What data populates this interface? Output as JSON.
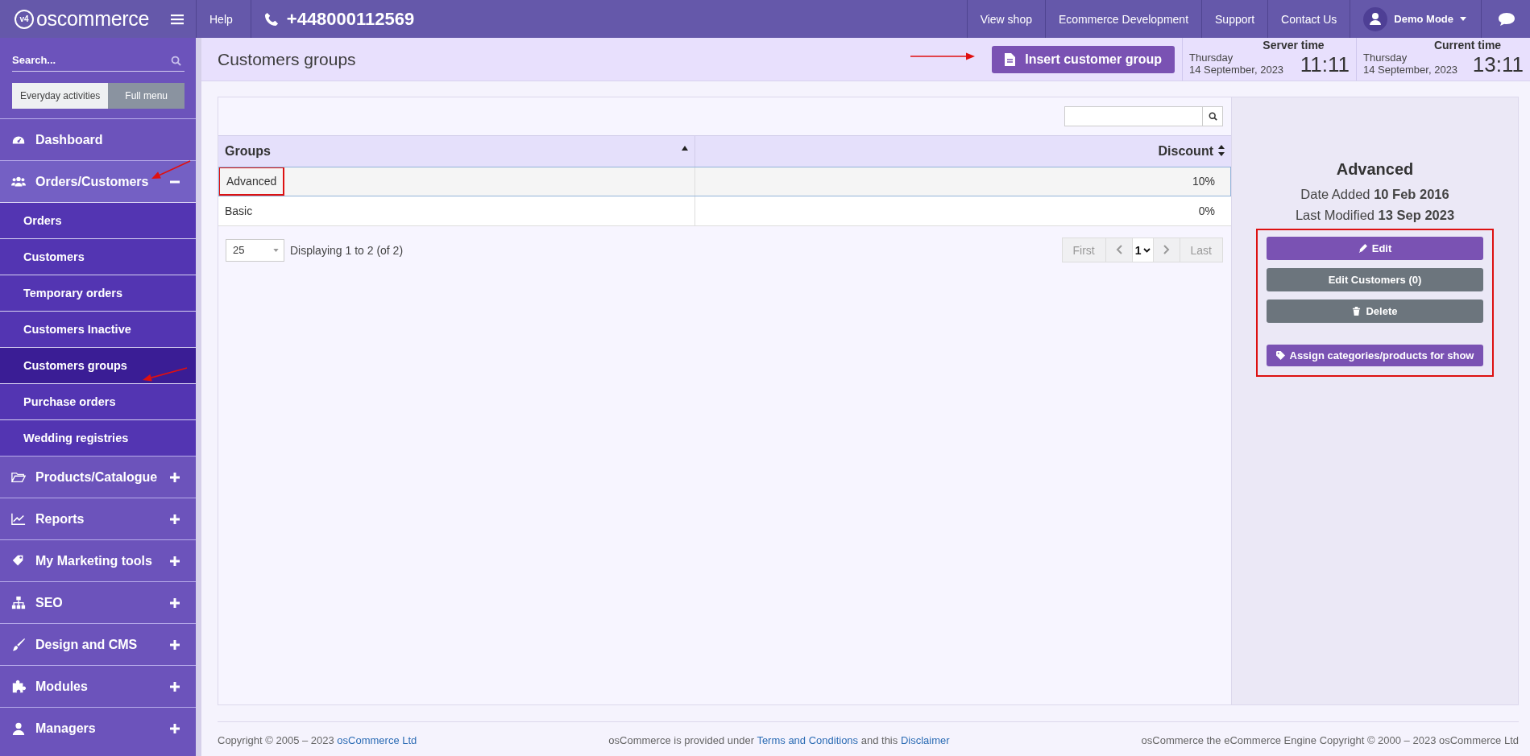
{
  "topbar": {
    "logo": "oscommerce",
    "logo_badge": "v4",
    "help": "Help",
    "phone": "+448000112569",
    "links": [
      "View shop",
      "Ecommerce Development",
      "Support",
      "Contact Us"
    ],
    "user": "Demo Mode"
  },
  "sidebar": {
    "search_placeholder": "Search...",
    "modes": [
      {
        "label": "Everyday activities",
        "selected": false
      },
      {
        "label": "Full menu",
        "selected": true
      }
    ],
    "items": [
      {
        "label": "Dashboard",
        "kind": "link",
        "selected": false
      },
      {
        "label": "Orders/Customers",
        "kind": "group",
        "expanded": true,
        "selected": false,
        "children": [
          {
            "label": "Orders",
            "selected": false
          },
          {
            "label": "Customers",
            "selected": false
          },
          {
            "label": "Temporary orders",
            "selected": false
          },
          {
            "label": "Customers Inactive",
            "selected": false
          },
          {
            "label": "Customers groups",
            "selected": true
          },
          {
            "label": "Purchase orders",
            "selected": false
          },
          {
            "label": "Wedding registries",
            "selected": false
          }
        ]
      },
      {
        "label": "Products/Catalogue",
        "kind": "group",
        "expanded": false,
        "selected": false
      },
      {
        "label": "Reports",
        "kind": "group",
        "expanded": false,
        "selected": false
      },
      {
        "label": "My Marketing tools",
        "kind": "group",
        "expanded": false,
        "selected": false
      },
      {
        "label": "SEO",
        "kind": "group",
        "expanded": false,
        "selected": false
      },
      {
        "label": "Design and CMS",
        "kind": "group",
        "expanded": false,
        "selected": false
      },
      {
        "label": "Modules",
        "kind": "group",
        "expanded": false,
        "selected": false
      },
      {
        "label": "Managers",
        "kind": "group",
        "expanded": false,
        "selected": false
      }
    ]
  },
  "header": {
    "title": "Customers groups",
    "insert_button": "Insert customer group",
    "clocks": [
      {
        "label": "Server time",
        "day": "Thursday",
        "date": "14 September, 2023",
        "time": "11:11"
      },
      {
        "label": "Current time",
        "day": "Thursday",
        "date": "14 September, 2023",
        "time": "13:11"
      }
    ]
  },
  "table": {
    "columns": [
      {
        "label": "Groups",
        "sorted": true
      },
      {
        "label": "Discount",
        "sorted": false
      }
    ],
    "rows": [
      {
        "cells": [
          "Advanced",
          "10%"
        ],
        "selected": true
      },
      {
        "cells": [
          "Basic",
          "0%"
        ],
        "selected": false
      }
    ]
  },
  "pager": {
    "per_page": "25",
    "summary": "Displaying 1 to 2 (of 2)",
    "first": "First",
    "page": "1",
    "last": "Last"
  },
  "details": {
    "title": "Advanced",
    "facts": [
      "Date Added **10 Feb 2016**",
      "Last Modified **13 Sep 2023**"
    ],
    "buttons": [
      {
        "label": "Edit",
        "kind": "primary"
      },
      {
        "label": "Edit Customers (0)",
        "kind": "secondary"
      },
      {
        "label": "Delete",
        "kind": "secondary"
      },
      {
        "label": "Assign categories/products for show",
        "kind": "primary"
      }
    ]
  },
  "footer": [
    [
      {
        "text": "Copyright © 2005 – 2023 "
      },
      {
        "link": "osCommerce Ltd"
      }
    ],
    [
      {
        "text": "osCommerce is provided under "
      },
      {
        "link": "Terms and Conditions"
      },
      {
        "text": " and this "
      },
      {
        "link": "Disclaimer"
      }
    ],
    [
      {
        "text": "osCommerce the eCommerce Engine Copyright © 2000 – 2023 osCommerce Ltd"
      }
    ]
  ]
}
